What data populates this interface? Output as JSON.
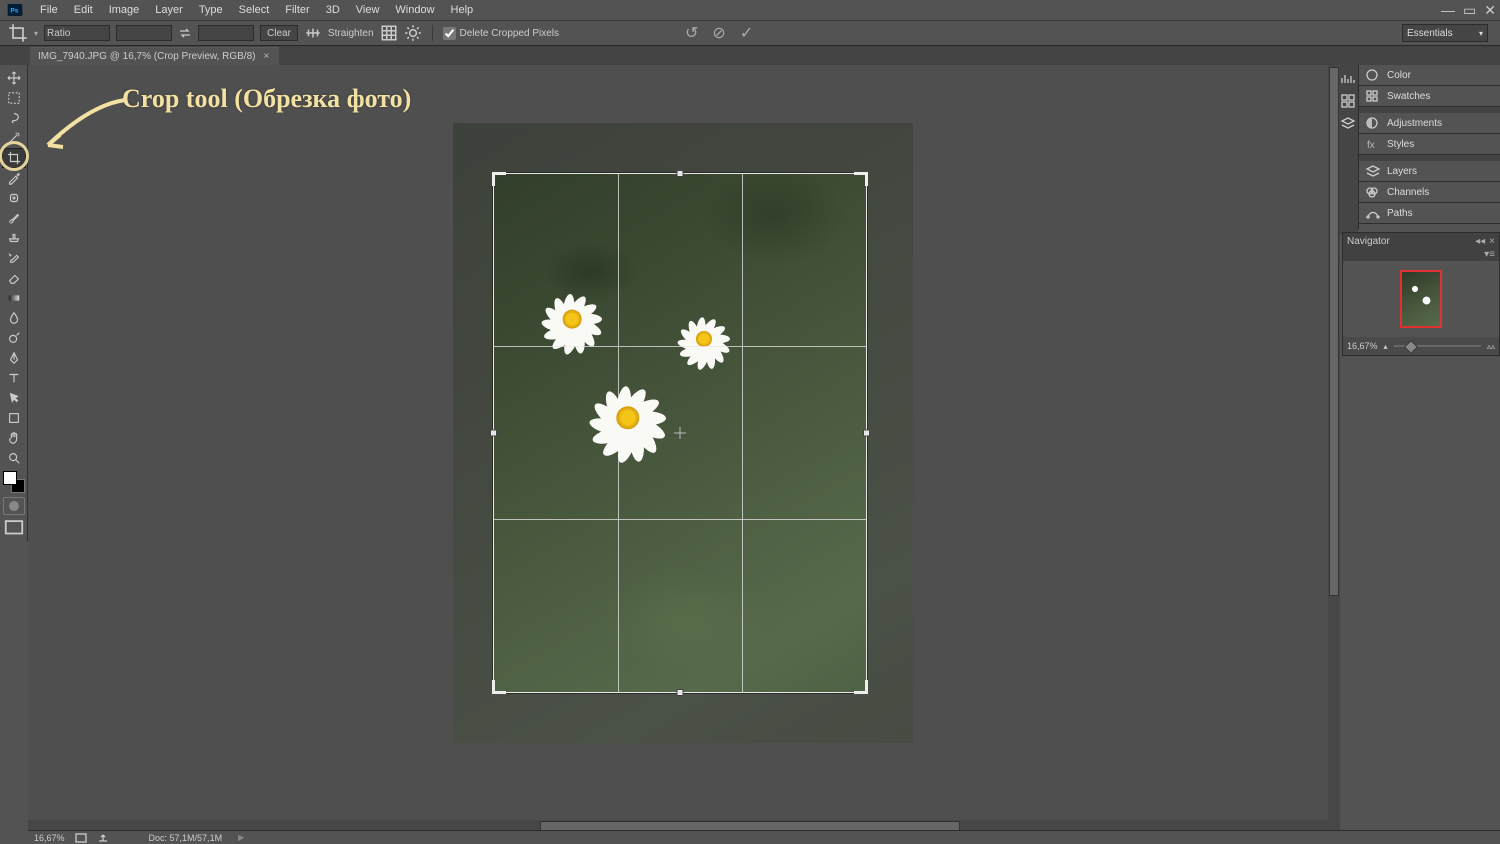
{
  "app_name": "Ps",
  "menu": [
    "File",
    "Edit",
    "Image",
    "Layer",
    "Type",
    "Select",
    "Filter",
    "3D",
    "View",
    "Window",
    "Help"
  ],
  "workspace": "Essentials",
  "options": {
    "preset": "Ratio",
    "w": "",
    "h": "",
    "clear": "Clear",
    "straighten": "Straighten",
    "delete_cropped": "Delete Cropped Pixels"
  },
  "doc_tab": "IMG_7940.JPG @ 16,7% (Crop Preview, RGB/8)",
  "tools": [
    "move",
    "marquee",
    "lasso",
    "wand",
    "crop",
    "eyedropper",
    "heal",
    "brush",
    "clone",
    "history",
    "eraser",
    "gradient",
    "blur",
    "dodge",
    "pen",
    "type",
    "path",
    "shape",
    "hand",
    "zoom"
  ],
  "selected_tool": "crop",
  "annotation": "Crop tool (Обрезка фото)",
  "right_panels": [
    "Color",
    "Swatches",
    "Adjustments",
    "Styles",
    "Layers",
    "Channels",
    "Paths"
  ],
  "navigator": {
    "title": "Navigator",
    "zoom": "16,67%"
  },
  "status": {
    "zoom": "16,67%",
    "doc": "Doc: 57,1M/57,1M"
  }
}
